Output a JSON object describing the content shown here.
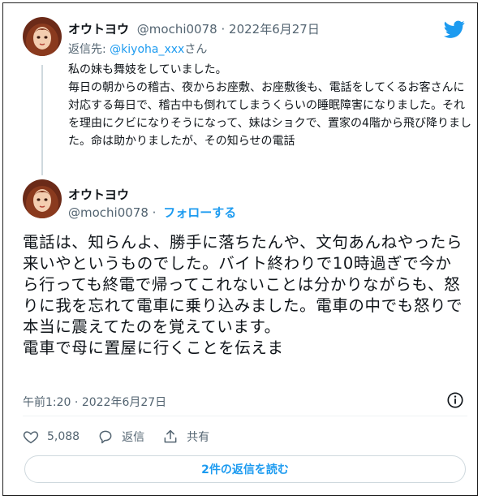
{
  "tweet1": {
    "display_name": "オウトヨウ",
    "handle": "@mochi0078",
    "separator": "·",
    "date": "2022年6月27日",
    "reply_prefix": "返信先:",
    "reply_to_handle": "@kiyoha_xxx",
    "reply_suffix": "さん",
    "body": "私の妹も舞妓をしていました。\n毎日の朝からの稽古、夜からお座敷、お座敷後も、電話をしてくるお客さんに対応する毎日で、稽古中も倒れてしまうくらいの睡眠障害になりました。それを理由にクビになりそうになって、妹はショクで、置家の4階から飛び降りました。命は助かりましたが、その知らせの電話"
  },
  "tweet2": {
    "display_name": "オウトヨウ",
    "handle": "@mochi0078",
    "separator": "·",
    "follow_label": "フォローする",
    "body": "電話は、知らんよ、勝手に落ちたんや、文句あんねやったら来いやというものでした。バイト終わりで10時過ぎで今から行っても終電で帰ってこれないことは分かりながらも、怒りに我を忘れて電車に乗り込みました。電車の中でも怒りで本当に震えてたのを覚えています。\n電車で母に置屋に行くことを伝えま",
    "time": "午前1:20",
    "date": "2022年6月27日",
    "like_count": "5,088",
    "reply_label": "返信",
    "share_label": "共有",
    "replies_button": "2件の返信を読む"
  },
  "colors": {
    "accent": "#1d9bf0",
    "muted": "#536471",
    "text": "#0f1419"
  }
}
